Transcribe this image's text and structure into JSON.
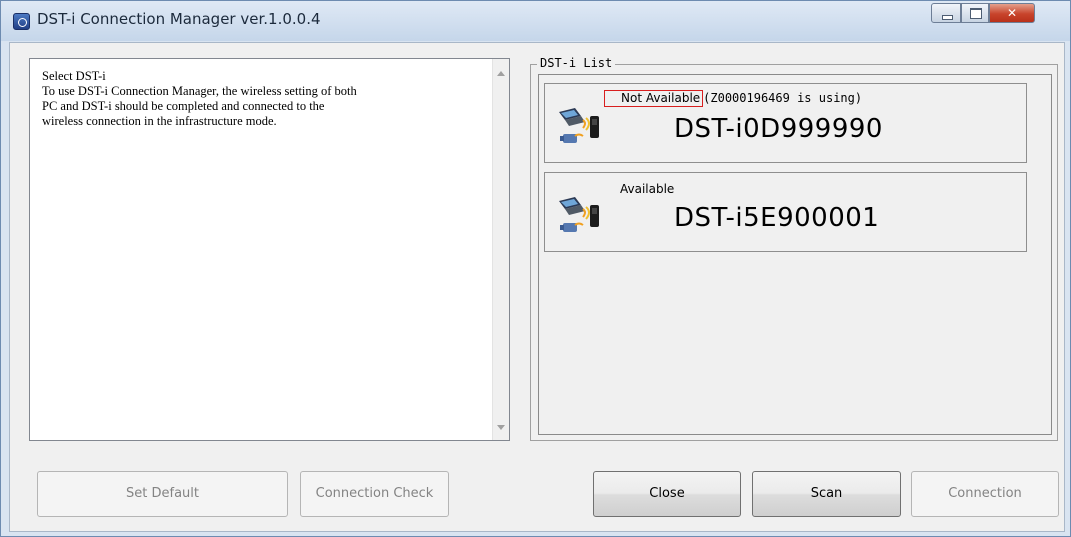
{
  "window": {
    "title": "DST-i Connection Manager ver.1.0.0.4"
  },
  "info_panel": {
    "lines": [
      "Select DST-i",
      "To use DST-i Connection Manager, the wireless setting of both",
      "PC and DST-i should be completed and connected to the",
      "wireless connection in the infrastructure mode."
    ]
  },
  "dst_list": {
    "legend": "DST-i List",
    "devices": [
      {
        "status": "Not Available",
        "status_detail": "(Z0000196469 is using)",
        "name": "DST-i0D999990",
        "highlight_color": "#d81e1e"
      },
      {
        "status": "Available",
        "status_detail": "",
        "name": "DST-i5E900001"
      }
    ]
  },
  "buttons": {
    "set_default": "Set Default",
    "connection_check": "Connection Check",
    "close": "Close",
    "scan": "Scan",
    "connection": "Connection"
  },
  "icons": {
    "app": "app-icon",
    "device": "laptop-wireless-device-icon"
  }
}
